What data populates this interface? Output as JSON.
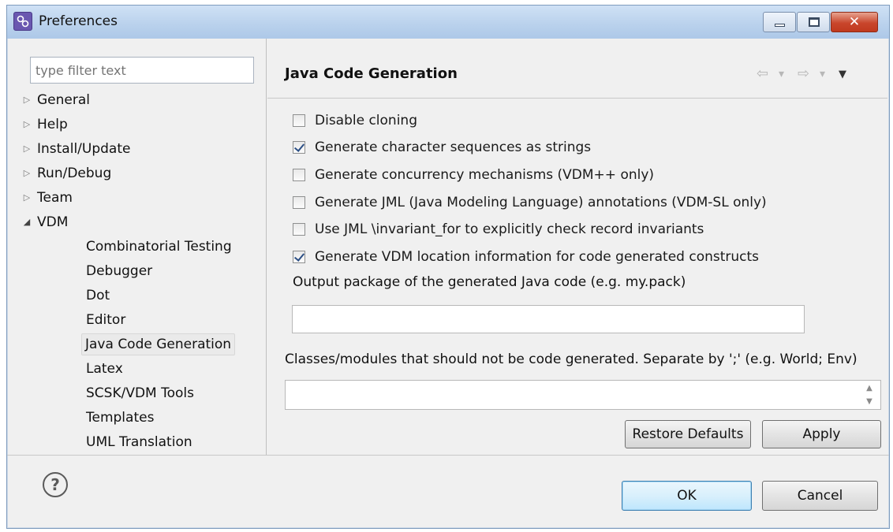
{
  "window": {
    "title": "Preferences",
    "close_glyph": "✕"
  },
  "sidebar": {
    "filter_placeholder": "type filter text",
    "items": [
      {
        "label": "General",
        "arrow": "▷"
      },
      {
        "label": "Help",
        "arrow": "▷"
      },
      {
        "label": "Install/Update",
        "arrow": "▷"
      },
      {
        "label": "Run/Debug",
        "arrow": "▷"
      },
      {
        "label": "Team",
        "arrow": "▷"
      },
      {
        "label": "VDM",
        "arrow": "◢"
      }
    ],
    "vdm_children": [
      {
        "label": "Combinatorial Testing"
      },
      {
        "label": "Debugger"
      },
      {
        "label": "Dot"
      },
      {
        "label": "Editor"
      },
      {
        "label": "Java Code Generation"
      },
      {
        "label": "Latex"
      },
      {
        "label": "SCSK/VDM Tools"
      },
      {
        "label": "Templates"
      },
      {
        "label": "UML Translation"
      }
    ]
  },
  "page": {
    "title": "Java Code Generation",
    "nav": {
      "back": "⇦",
      "forward": "⇨",
      "dropdown": "▾",
      "menu": "▼"
    },
    "options": [
      {
        "label": "Disable cloning",
        "checked": false
      },
      {
        "label": "Generate character sequences as strings",
        "checked": true
      },
      {
        "label": "Generate concurrency mechanisms (VDM++ only)",
        "checked": false
      },
      {
        "label": "Generate JML (Java Modeling Language) annotations (VDM-SL only)",
        "checked": false
      },
      {
        "label": "Use JML \\invariant_for to explicitly check record invariants",
        "checked": false
      },
      {
        "label": "Generate VDM location information for code generated constructs",
        "checked": true
      }
    ],
    "package_label": "Output package of the generated Java code (e.g. my.pack)",
    "package_value": "",
    "classes_label": "Classes/modules that should not be code generated. Separate by ';' (e.g. World; Env)",
    "classes_value": "",
    "spin_up": "▲",
    "spin_down": "▼",
    "restore_defaults": "Restore Defaults",
    "apply": "Apply"
  },
  "footer": {
    "help_glyph": "?",
    "ok": "OK",
    "cancel": "Cancel"
  }
}
